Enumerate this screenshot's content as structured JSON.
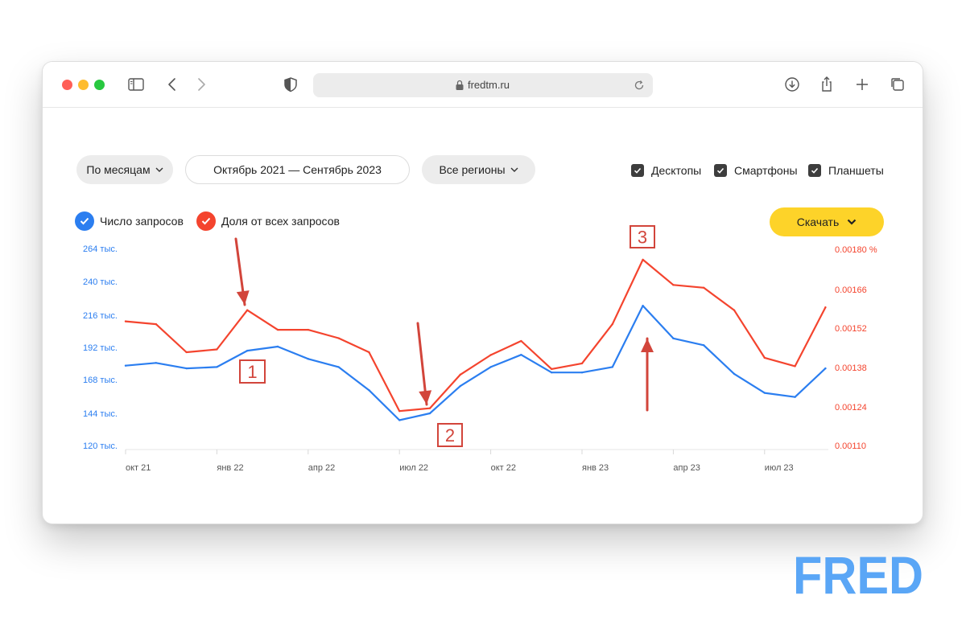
{
  "browser": {
    "url": "fredtm.ru"
  },
  "controls": {
    "period_label": "По месяцам",
    "date_range": "Октябрь 2021 — Сентябрь 2023",
    "regions_label": "Все регионы",
    "devices": [
      {
        "label": "Десктопы",
        "checked": true
      },
      {
        "label": "Смартфоны",
        "checked": true
      },
      {
        "label": "Планшеты",
        "checked": true
      }
    ],
    "download_label": "Скачать"
  },
  "legend": [
    {
      "label": "Число запросов",
      "color": "#2b7ef0"
    },
    {
      "label": "Доля от всех запросов",
      "color": "#f4442e"
    }
  ],
  "chart_data": {
    "type": "line",
    "x_tick_labels": [
      "окт 21",
      "янв 22",
      "апр 22",
      "июл 22",
      "окт 22",
      "янв 23",
      "апр 23",
      "июл 23"
    ],
    "categories": [
      "окт 21",
      "ноя 21",
      "дек 21",
      "янв 22",
      "фев 22",
      "мар 22",
      "апр 22",
      "май 22",
      "июн 22",
      "июл 22",
      "авг 22",
      "сен 22",
      "окт 22",
      "ноя 22",
      "дек 22",
      "янв 23",
      "фев 23",
      "мар 23",
      "апр 23",
      "май 23",
      "июн 23",
      "июл 23",
      "авг 23",
      "сен 23"
    ],
    "y_left": {
      "tick_labels": [
        "264 тыс.",
        "240 тыс.",
        "216 тыс.",
        "192 тыс.",
        "168 тыс.",
        "144 тыс.",
        "120 тыс."
      ],
      "ticks": [
        264,
        240,
        216,
        192,
        168,
        144,
        120
      ],
      "range": [
        120,
        264
      ],
      "color": "#2b7ef0"
    },
    "y_right": {
      "tick_labels": [
        "0.00180 %",
        "0.00166",
        "0.00152",
        "0.00138",
        "0.00124",
        "0.00110"
      ],
      "ticks": [
        0.0018,
        0.00166,
        0.00152,
        0.00138,
        0.00124,
        0.0011
      ],
      "range": [
        0.0011,
        0.0018
      ],
      "color": "#f4442e"
    },
    "series": [
      {
        "name": "Число запросов",
        "axis": "left",
        "color": "#2b7ef0",
        "values": [
          178,
          180,
          176,
          177,
          189,
          192,
          183,
          177,
          160,
          138,
          143,
          163,
          177,
          186,
          173,
          173,
          177,
          222,
          198,
          193,
          172,
          158,
          155,
          176
        ]
      },
      {
        "name": "Доля от всех запросов",
        "axis": "right",
        "color": "#f4442e",
        "values": [
          0.00154,
          0.00153,
          0.00143,
          0.00144,
          0.00158,
          0.00151,
          0.00151,
          0.00148,
          0.00143,
          0.00122,
          0.00123,
          0.00135,
          0.00142,
          0.00147,
          0.00137,
          0.00139,
          0.00153,
          0.00176,
          0.00167,
          0.00166,
          0.00158,
          0.00141,
          0.00138,
          0.00159
        ]
      }
    ],
    "annotations": [
      {
        "label": "1"
      },
      {
        "label": "2"
      },
      {
        "label": "3"
      }
    ],
    "annotation_color": "#d2453b"
  },
  "watermark": {
    "text": "FRED",
    "color": "#5aa6f6"
  }
}
